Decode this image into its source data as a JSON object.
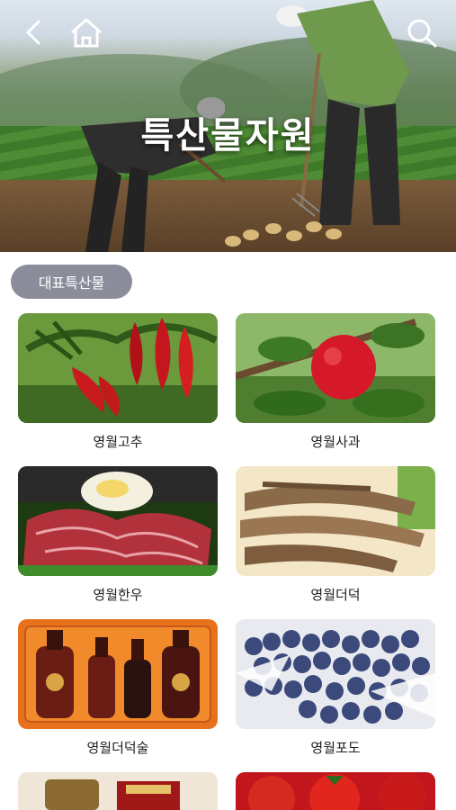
{
  "header": {
    "title": "특산물자원"
  },
  "nav": {
    "back_icon": "chevron-left-icon",
    "home_icon": "home-icon",
    "search_icon": "search-icon"
  },
  "section": {
    "chip_label": "대표특산물"
  },
  "products": [
    {
      "label": "영월고추"
    },
    {
      "label": "영월사과"
    },
    {
      "label": "영월한우"
    },
    {
      "label": "영월더덕"
    },
    {
      "label": "영월더덕술"
    },
    {
      "label": "영월포도"
    }
  ]
}
